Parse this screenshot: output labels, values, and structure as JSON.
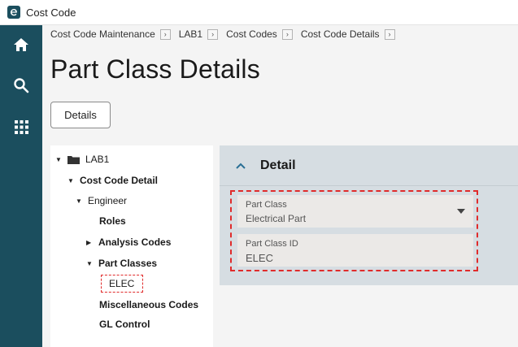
{
  "app": {
    "title": "Cost Code"
  },
  "nav": {
    "home": "home-icon",
    "search": "search-icon",
    "apps": "apps-grid-icon"
  },
  "breadcrumbs": [
    "Cost Code Maintenance",
    "LAB1",
    "Cost Codes",
    "Cost Code Details"
  ],
  "page": {
    "title": "Part Class Details"
  },
  "toolbar": {
    "details_label": "Details"
  },
  "tree": {
    "root": "LAB1",
    "cost_code_detail": "Cost Code Detail",
    "engineer": "Engineer",
    "roles": "Roles",
    "analysis_codes": "Analysis Codes",
    "part_classes": "Part Classes",
    "elec": "ELEC",
    "misc_codes": "Miscellaneous Codes",
    "gl_control": "GL Control"
  },
  "detail": {
    "title": "Detail",
    "part_class": {
      "label": "Part Class",
      "value": "Electrical Part"
    },
    "part_class_id": {
      "label": "Part Class ID",
      "value": "ELEC"
    }
  },
  "colors": {
    "nav_bg": "#1b4e5e",
    "panel_bg": "#d6dde2",
    "field_bg": "#ebe9e7",
    "highlight": "#e02b2b",
    "accent": "#2a6f95"
  }
}
